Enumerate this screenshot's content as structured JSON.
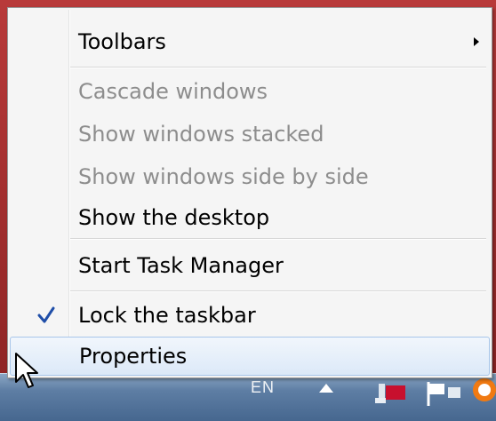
{
  "menu": {
    "toolbars": "Toolbars",
    "cascade": "Cascade windows",
    "stacked": "Show windows stacked",
    "side_by_side": "Show windows side by side",
    "show_desktop": "Show the desktop",
    "task_manager": "Start Task Manager",
    "lock_taskbar": "Lock the taskbar",
    "properties": "Properties"
  },
  "state": {
    "lock_taskbar_checked": true,
    "hovered_item": "Properties"
  },
  "taskbar": {
    "language": "EN"
  },
  "colors": {
    "menu_bg": "#f5f5f5",
    "disabled_text": "#8d8d8d",
    "hover_bg": "#dce9f8",
    "hover_border": "#a8c6ea",
    "check": "#1f4ea8",
    "desktop": "#b83a3a"
  },
  "icons": [
    "submenu-arrow-icon",
    "checkmark-icon",
    "mouse-pointer-icon",
    "show-hidden-icons-icon",
    "network-icon",
    "action-center-flag-icon"
  ]
}
